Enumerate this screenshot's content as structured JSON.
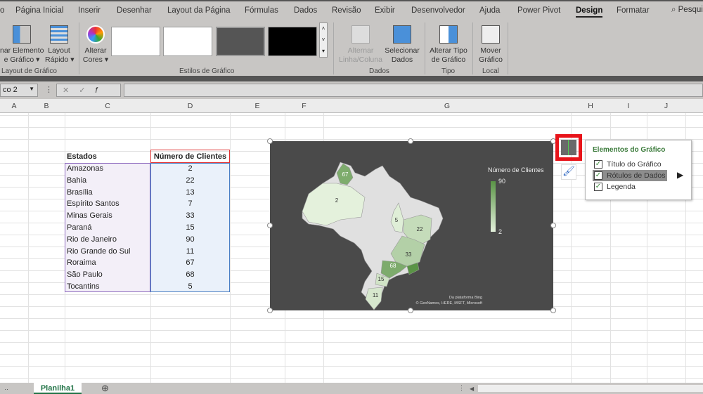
{
  "tabs": [
    "o",
    "Página Inicial",
    "Inserir",
    "Desenhar",
    "Layout da Página",
    "Fórmulas",
    "Dados",
    "Revisão",
    "Exibir",
    "Desenvolvedor",
    "Ajuda",
    "Power Pivot",
    "Design",
    "Formatar"
  ],
  "active_tab": "Design",
  "search_label": "Pesqui",
  "ribbon": {
    "add_element": "nar Elemento\ne Gráfico ▾",
    "quick_layout": "Layout\nRápido ▾",
    "group_layout": "Layout de Gráfico",
    "change_colors": "Alterar\nCores ▾",
    "group_styles": "Estilos de Gráfico",
    "switch_row_col": "Alternar\nLinha/Coluna",
    "select_data": "Selecionar\nDados",
    "group_data": "Dados",
    "change_type": "Alterar Tipo\nde Gráfico",
    "group_type": "Tipo",
    "move_chart": "Mover\nGráfico",
    "group_local": "Local"
  },
  "name_box": "co 2",
  "columns": [
    "A",
    "B",
    "C",
    "D",
    "E",
    "F",
    "G",
    "H",
    "I",
    "J"
  ],
  "table": {
    "headers": [
      "Estados",
      "Número de Clientes"
    ],
    "rows": [
      [
        "Amazonas",
        "2"
      ],
      [
        "Bahia",
        "22"
      ],
      [
        "Brasília",
        "13"
      ],
      [
        "Espírito Santos",
        "7"
      ],
      [
        "Minas Gerais",
        "33"
      ],
      [
        "Paraná",
        "15"
      ],
      [
        "Rio de Janeiro",
        "90"
      ],
      [
        "Rio Grande do Sul",
        "11"
      ],
      [
        "Roraima",
        "67"
      ],
      [
        "São Paulo",
        "68"
      ],
      [
        "Tocantins",
        "5"
      ]
    ]
  },
  "chart_data": {
    "type": "map",
    "legend_title": "Número de Clientes",
    "legend_max": "90",
    "legend_min": "2",
    "range": [
      2,
      90
    ],
    "colors": {
      "low": "#e4f1dc",
      "high": "#5a9446",
      "unfilled": "#e0e0e0",
      "background": "#4a4a4a"
    },
    "regions": [
      {
        "name": "Amazonas",
        "value": 2,
        "label": "2"
      },
      {
        "name": "Roraima",
        "value": 67,
        "label": "67"
      },
      {
        "name": "Tocantins",
        "value": 5,
        "label": "5"
      },
      {
        "name": "Bahia",
        "value": 22,
        "label": "22"
      },
      {
        "name": "Minas Gerais",
        "value": 33,
        "label": "33"
      },
      {
        "name": "São Paulo",
        "value": 68,
        "label": "68"
      },
      {
        "name": "Rio de Janeiro",
        "value": 90,
        "label": ""
      },
      {
        "name": "Paraná",
        "value": 15,
        "label": "15"
      },
      {
        "name": "Rio Grande do Sul",
        "value": 11,
        "label": "11"
      }
    ],
    "attribution_1": "Da plataforma Bing",
    "attribution_2": "© GeoNames, HERE, MSFT, Microsoft"
  },
  "elements_panel": {
    "title": "Elementos do Gráfico",
    "items": [
      {
        "label": "Título do Gráfico",
        "checked": true
      },
      {
        "label": "Rótulos de Dados",
        "checked": true
      },
      {
        "label": "Legenda",
        "checked": true
      }
    ]
  },
  "sheet_tab": "Planilha1"
}
